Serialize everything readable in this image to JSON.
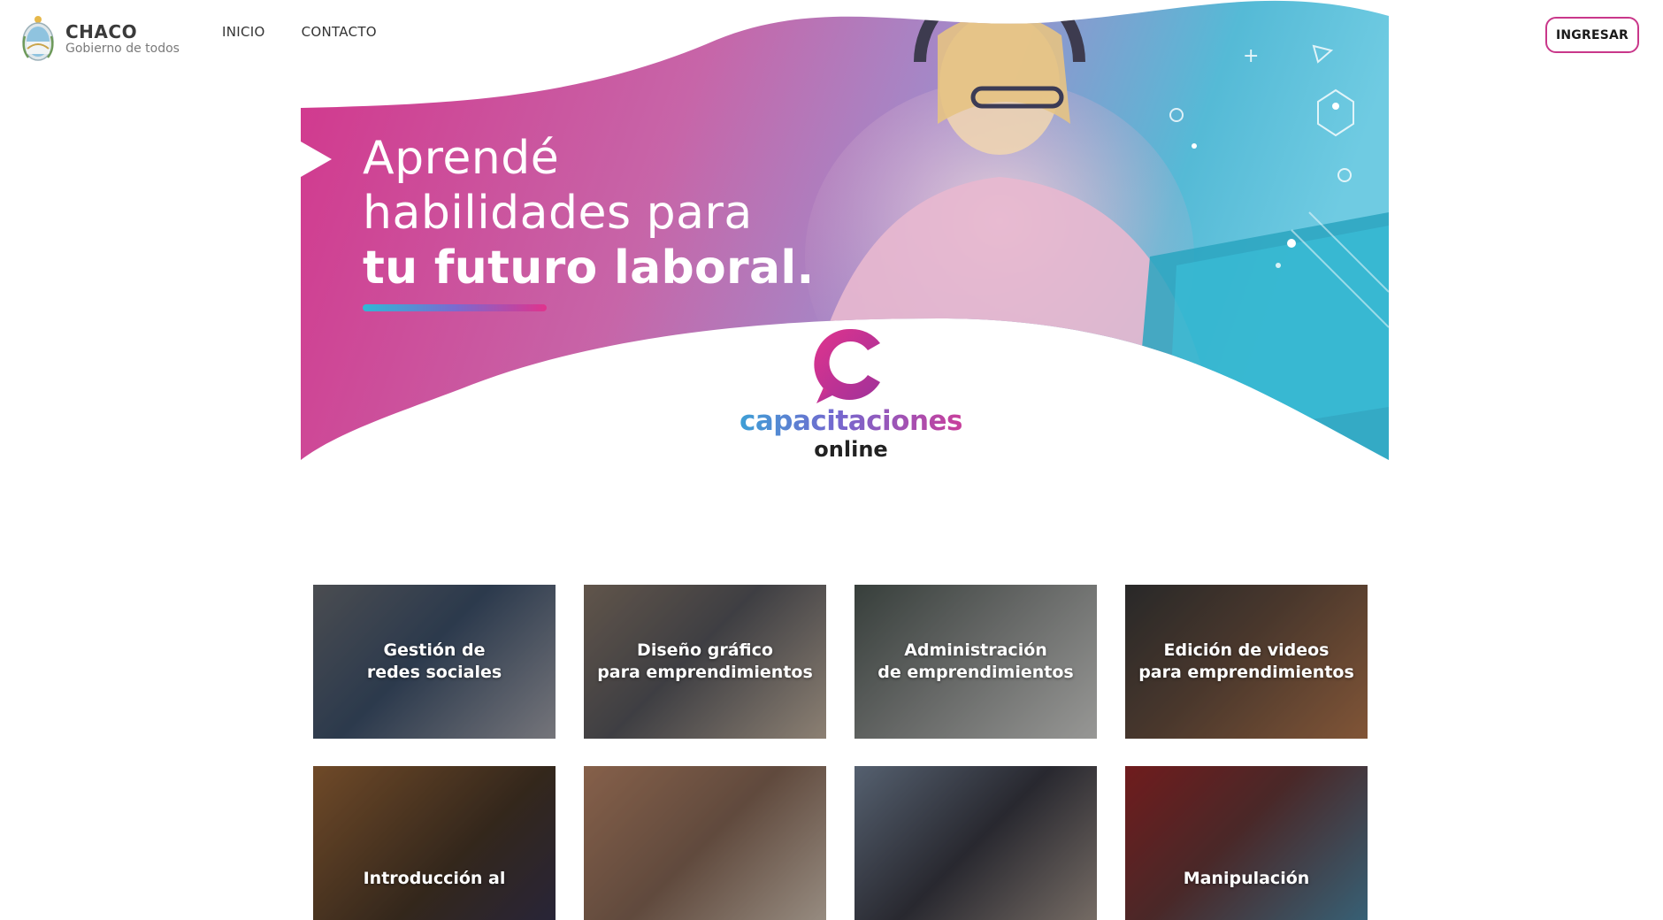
{
  "header": {
    "logo": {
      "title": "CHACO",
      "subtitle": "Gobierno de todos"
    },
    "nav": [
      {
        "label": "INICIO"
      },
      {
        "label": "CONTACTO"
      }
    ],
    "login_label": "INGRESAR"
  },
  "hero": {
    "line1": "Aprendé",
    "line2": "habilidades para",
    "line3": "tu futuro laboral.",
    "brand_name": "capacitaciones",
    "brand_suffix": "online"
  },
  "colors": {
    "pink": "#d2368c",
    "magenta": "#c9378a",
    "purple": "#8b6cc9",
    "cyan": "#3ec0da",
    "text_dark": "#333333"
  },
  "courses": [
    {
      "title": "Gestión de\nredes sociales"
    },
    {
      "title": "Diseño gráfico\npara emprendimientos"
    },
    {
      "title": "Administración\nde emprendimientos"
    },
    {
      "title": "Edición de videos\npara emprendimientos"
    },
    {
      "title": "Introducción al"
    },
    {
      "title": ""
    },
    {
      "title": ""
    },
    {
      "title": "Manipulación"
    }
  ]
}
